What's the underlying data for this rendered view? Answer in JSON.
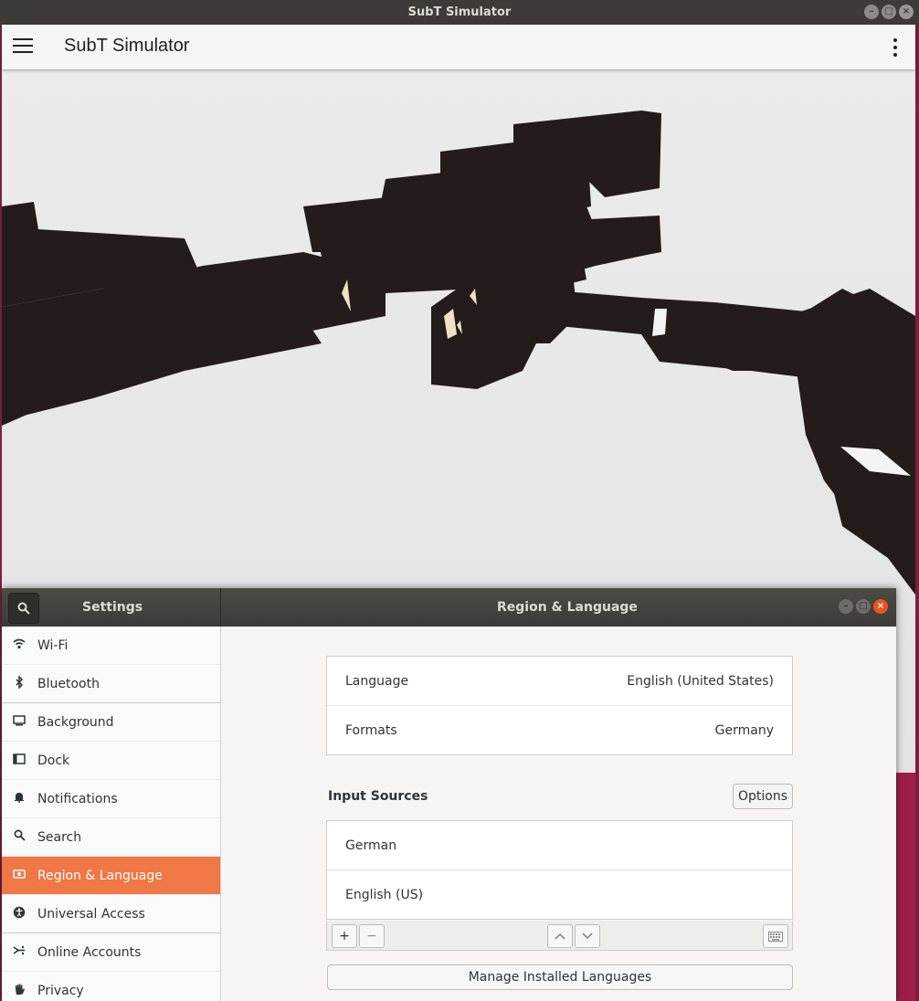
{
  "simulator": {
    "window_title": "SubT Simulator",
    "app_title": "SubT Simulator",
    "menu_icon": "hamburger-menu-icon",
    "overflow_icon": "kebab-menu-icon"
  },
  "settings": {
    "panel_title": "Settings",
    "page_title": "Region & Language",
    "sidebar": {
      "items": [
        {
          "label": "Wi-Fi",
          "icon": "wifi-icon"
        },
        {
          "label": "Bluetooth",
          "icon": "bluetooth-icon"
        },
        {
          "label": "Background",
          "icon": "background-icon"
        },
        {
          "label": "Dock",
          "icon": "dock-icon"
        },
        {
          "label": "Notifications",
          "icon": "bell-icon"
        },
        {
          "label": "Search",
          "icon": "search-icon"
        },
        {
          "label": "Region & Language",
          "icon": "region-icon",
          "selected": true
        },
        {
          "label": "Universal Access",
          "icon": "accessibility-icon"
        },
        {
          "label": "Online Accounts",
          "icon": "online-accounts-icon"
        },
        {
          "label": "Privacy",
          "icon": "hand-icon"
        }
      ]
    },
    "language": {
      "label": "Language",
      "value": "English (United States)"
    },
    "formats": {
      "label": "Formats",
      "value": "Germany"
    },
    "input_sources": {
      "title": "Input Sources",
      "options_label": "Options",
      "items": [
        "German",
        "English (US)"
      ],
      "add_label": "+",
      "remove_label": "−"
    },
    "manage_label": "Manage Installed Languages"
  },
  "colors": {
    "selected_accent": "#f07746",
    "close_button": "#e95420",
    "titlebar": "#3c3b37"
  }
}
